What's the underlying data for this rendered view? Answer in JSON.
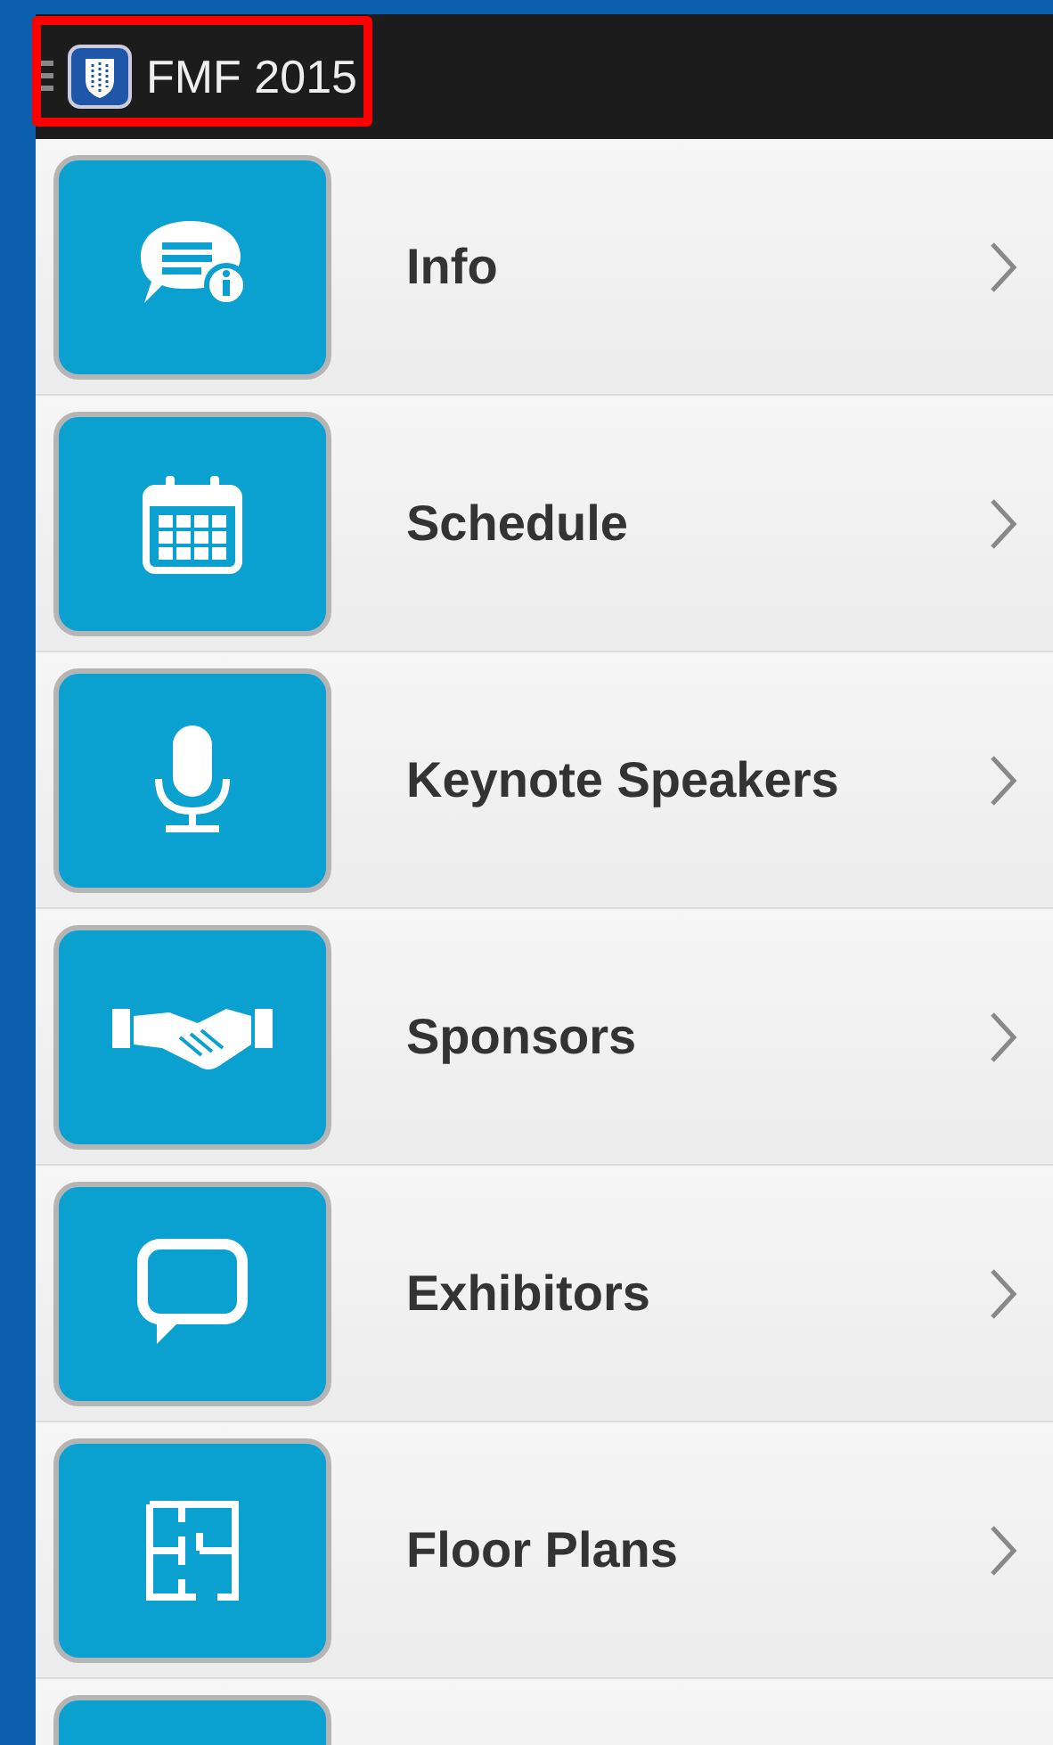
{
  "app_bar": {
    "title": "FMF 2015",
    "highlighted": true
  },
  "menu": [
    {
      "label": "Info",
      "kind": "info"
    },
    {
      "label": "Schedule",
      "kind": "calendar"
    },
    {
      "label": "Keynote Speakers",
      "kind": "microphone"
    },
    {
      "label": "Sponsors",
      "kind": "handshake"
    },
    {
      "label": "Exhibitors",
      "kind": "chat"
    },
    {
      "label": "Floor Plans",
      "kind": "floorplan"
    }
  ]
}
